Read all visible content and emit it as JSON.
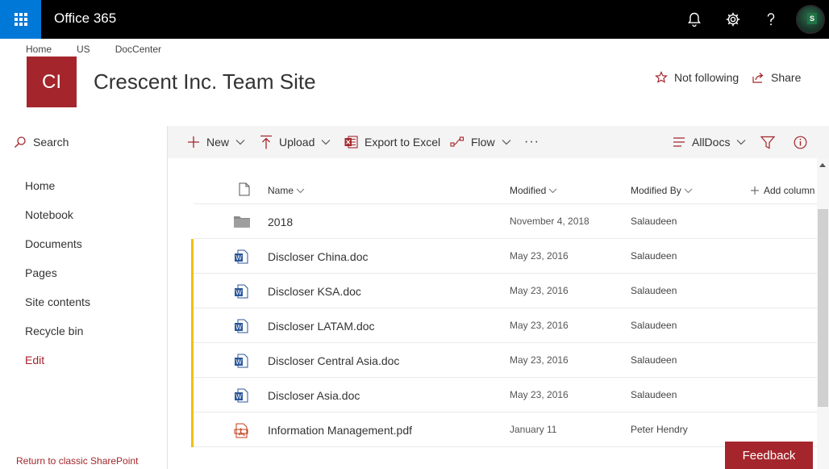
{
  "suite": {
    "brand": "Office 365"
  },
  "header": {
    "breadcrumbs": [
      "Home",
      "US",
      "DocCenter"
    ],
    "logo_text": "CI",
    "logo_color": "#a4262c",
    "site_title": "Crescent Inc. Team Site",
    "follow_label": "Not following",
    "share_label": "Share"
  },
  "leftnav": {
    "search_label": "Search",
    "items": [
      "Home",
      "Notebook",
      "Documents",
      "Pages",
      "Site contents",
      "Recycle bin"
    ],
    "edit_label": "Edit",
    "classic_link": "Return to classic SharePoint"
  },
  "commandbar": {
    "new_label": "New",
    "upload_label": "Upload",
    "export_label": "Export to Excel",
    "flow_label": "Flow",
    "more_label": "···",
    "view_label": "AllDocs"
  },
  "list": {
    "columns": {
      "name": "Name",
      "modified": "Modified",
      "modified_by": "Modified By",
      "add_column": "Add column"
    },
    "rows": [
      {
        "name": "2018",
        "modified": "November 4, 2018",
        "by": "Salaudeen",
        "type": "folder-icon",
        "new": false
      },
      {
        "name": "Discloser China.doc",
        "modified": "May 23, 2016",
        "by": "Salaudeen",
        "type": "word-doc-icon",
        "new": true
      },
      {
        "name": "Discloser KSA.doc",
        "modified": "May 23, 2016",
        "by": "Salaudeen",
        "type": "word-doc-icon",
        "new": true
      },
      {
        "name": "Discloser LATAM.doc",
        "modified": "May 23, 2016",
        "by": "Salaudeen",
        "type": "word-doc-icon",
        "new": true
      },
      {
        "name": "Discloser Central Asia.doc",
        "modified": "May 23, 2016",
        "by": "Salaudeen",
        "type": "word-doc-icon",
        "new": true
      },
      {
        "name": "Discloser Asia.doc",
        "modified": "May 23, 2016",
        "by": "Salaudeen",
        "type": "word-doc-icon",
        "new": true
      },
      {
        "name": "Information Management.pdf",
        "modified": "January 11",
        "by": "Peter Hendry",
        "type": "pdf-icon",
        "new": true
      }
    ]
  },
  "feedback_label": "Feedback",
  "colors": {
    "accent": "#a4262c",
    "suitebar": "#000000",
    "waffle": "#0078d7",
    "new_indicator": "#f0c000"
  }
}
